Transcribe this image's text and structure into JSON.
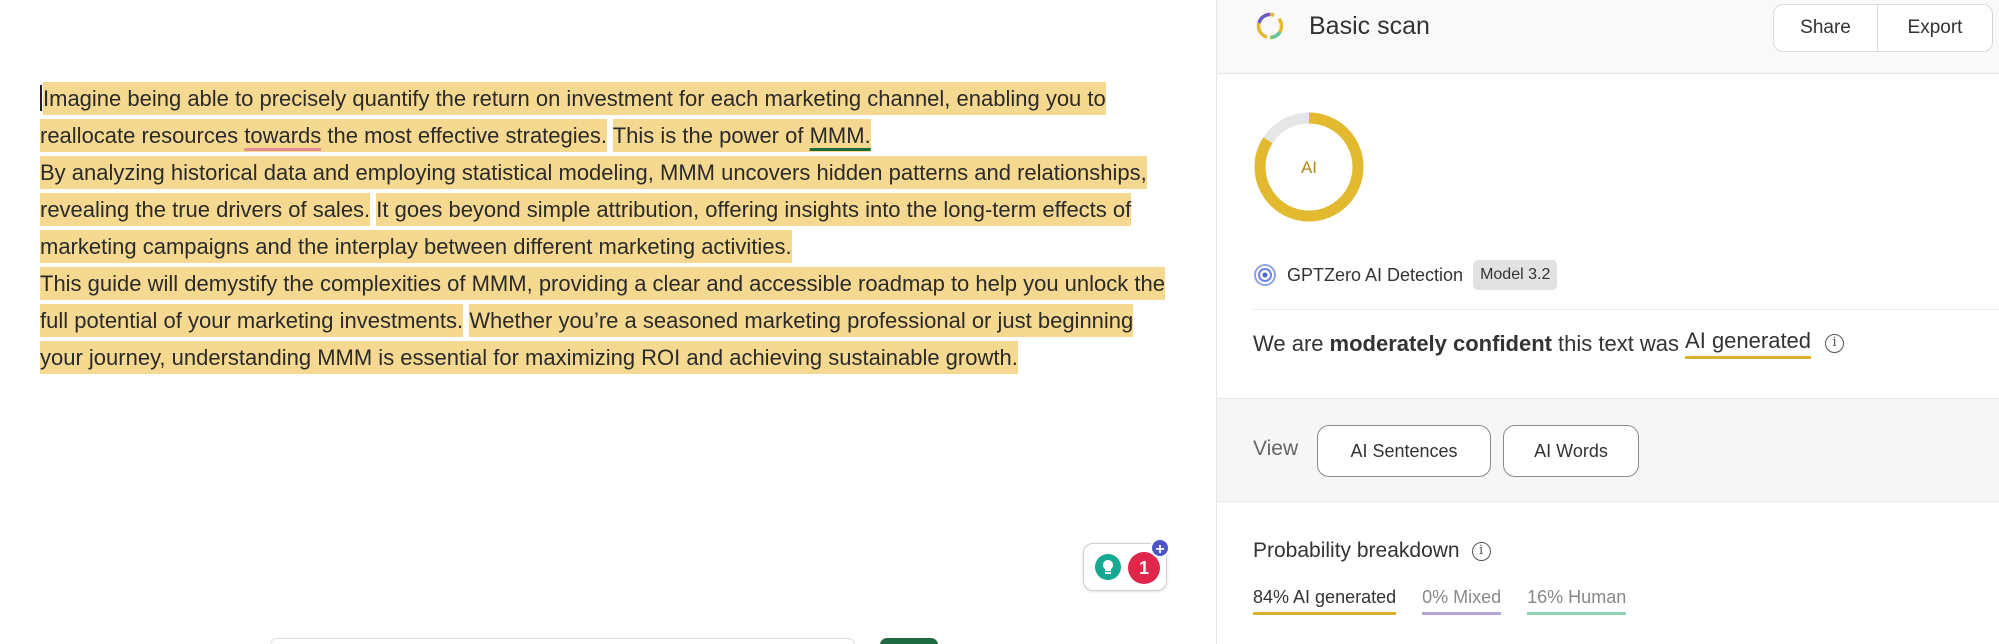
{
  "editor": {
    "segments": [
      {
        "text": "Imagine being able to precisely quantify the return on investment for each marketing channel, enabling you to reallocate resources ",
        "hl": true
      },
      {
        "text": "towards",
        "hl": true,
        "underline": "red"
      },
      {
        "text": " the most effective strategies.",
        "hl": true
      },
      {
        "text": " ",
        "hl": false
      },
      {
        "text": "This is the power of ",
        "hl": true
      },
      {
        "text": "MMM.",
        "hl": true,
        "underline": "green"
      },
      {
        "text": "\n",
        "hl": false
      },
      {
        "text": "By analyzing historical data and employing statistical modeling, MMM uncovers hidden patterns and relationships, revealing the true drivers of sales.",
        "hl": true
      },
      {
        "text": " ",
        "hl": false
      },
      {
        "text": "It goes beyond simple attribution, offering insights into the long-term effects of marketing campaigns and the interplay between different marketing activities.",
        "hl": true
      },
      {
        "text": "\n",
        "hl": false
      },
      {
        "text": "This guide will demystify the complexities of MMM, providing a clear and accessible roadmap to help you unlock the full potential of your marketing investments.",
        "hl": true
      },
      {
        "text": " ",
        "hl": false
      },
      {
        "text": "Whether you’re a seasoned marketing professional or just beginning your journey, understanding MMM is essential for maximizing ROI and achieving sustainable growth.",
        "hl": true
      }
    ],
    "widget": {
      "badge_count": "1"
    }
  },
  "panel": {
    "title": "Basic scan",
    "share_label": "Share",
    "export_label": "Export",
    "donut_label": "AI",
    "detector_name": "GPTZero AI Detection",
    "model_tag": "Model 3.2",
    "verdict": {
      "prefix": "We are",
      "confidence": "moderately confident",
      "middle": "this text was",
      "result": "AI generated"
    },
    "view_label": "View",
    "view_buttons": {
      "sentences": "AI Sentences",
      "words": "AI Words"
    },
    "probability_title": "Probability breakdown",
    "probabilities": {
      "ai": {
        "label": "84% AI generated",
        "value": 84
      },
      "mixed": {
        "label": "0% Mixed",
        "value": 0
      },
      "human": {
        "label": "16% Human",
        "value": 16
      }
    }
  },
  "colors": {
    "highlight": "#f6d990",
    "ai": "#e2b92f",
    "mixed": "#b6a6dd",
    "human": "#8fd3b0",
    "badge": "#e0274a"
  }
}
